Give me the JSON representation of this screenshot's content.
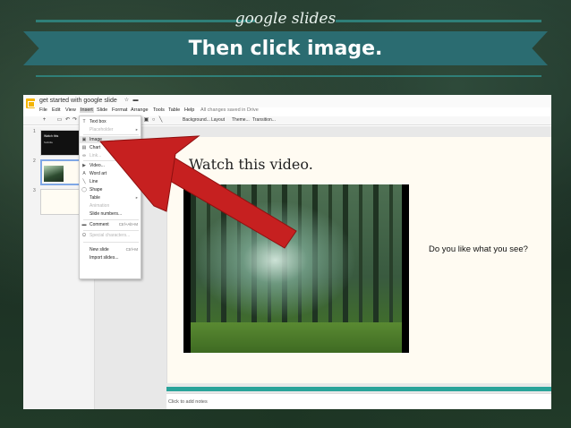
{
  "header": {
    "eyebrow": "google slides",
    "title": "Then click image."
  },
  "app": {
    "doc_title": "get started with google slide",
    "menu": [
      "File",
      "Edit",
      "View",
      "Insert",
      "Slide",
      "Format",
      "Arrange",
      "Tools",
      "Table",
      "Help"
    ],
    "saved_status": "All changes saved in Drive",
    "toolbar_buttons": [
      "Background...",
      "Layout",
      "Theme...",
      "Transition..."
    ]
  },
  "filmstrip": {
    "slide_numbers": [
      "1",
      "2",
      "3"
    ],
    "thumb1_title": "Watch this",
    "thumb1_subtitle": "Subtitle"
  },
  "slide": {
    "title": "Watch this video.",
    "question": "Do you like what you see?",
    "notes": "Click to add notes"
  },
  "insert_menu": {
    "items": [
      {
        "label": "Text box",
        "icon": "text-box-icon",
        "enabled": true
      },
      {
        "label": "Placeholder",
        "icon": "",
        "enabled": false
      },
      {
        "label": "Image",
        "icon": "image-icon",
        "enabled": true
      },
      {
        "label": "Chart",
        "icon": "chart-icon",
        "enabled": true
      },
      {
        "label": "Link...",
        "icon": "link-icon",
        "enabled": false
      },
      {
        "label": "Video...",
        "icon": "video-icon",
        "enabled": true
      },
      {
        "label": "Word art",
        "icon": "word-art-icon",
        "enabled": true
      },
      {
        "label": "Line",
        "icon": "line-icon",
        "enabled": true
      },
      {
        "label": "Shape",
        "icon": "shape-icon",
        "enabled": true
      },
      {
        "label": "Table",
        "icon": "",
        "enabled": true
      },
      {
        "label": "Animation",
        "icon": "",
        "enabled": false
      },
      {
        "label": "Slide numbers...",
        "icon": "",
        "enabled": true
      },
      {
        "label": "Comment",
        "icon": "comment-icon",
        "enabled": true,
        "shortcut": "Ctrl+Alt+M"
      },
      {
        "label": "Special characters...",
        "icon": "special-char-icon",
        "enabled": false
      },
      {
        "label": "New slide",
        "icon": "",
        "enabled": true,
        "shortcut": "Ctrl+M"
      },
      {
        "label": "Import slides...",
        "icon": "",
        "enabled": true
      }
    ]
  },
  "colors": {
    "banner": "#2b6c71",
    "arrow": "#c62020",
    "accent_bar": "#2aa39a"
  }
}
